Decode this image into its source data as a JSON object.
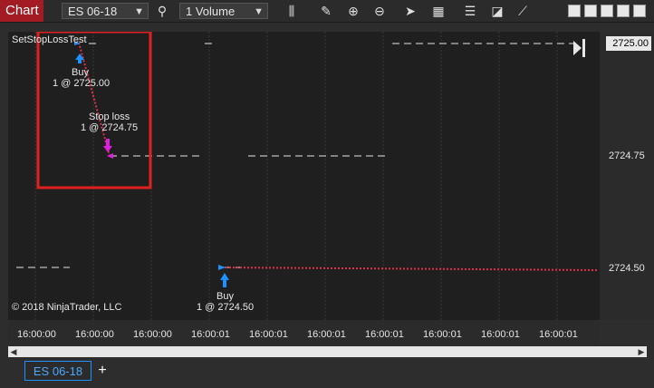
{
  "toolbar": {
    "title": "Chart",
    "instrument": "ES 06-18",
    "interval": "1 Volume"
  },
  "chart": {
    "strategy_label": "SetStopLossTest",
    "copyright": "© 2018 NinjaTrader, LLC",
    "price_axis": {
      "current_price": "2725.00",
      "labels": [
        "2724.75",
        "2724.50"
      ]
    },
    "time_axis": {
      "labels": [
        "16:00:00",
        "16:00:00",
        "16:00:00",
        "16:00:01",
        "16:00:01",
        "16:00:01",
        "16:00:01",
        "16:00:01",
        "16:00:01",
        "16:00:01"
      ]
    },
    "executions": [
      {
        "side": "Buy",
        "detail": "1 @ 2725.00"
      },
      {
        "side": "Stop loss",
        "detail": "1 @ 2724.75"
      },
      {
        "side": "Buy",
        "detail": "1 @ 2724.50"
      }
    ],
    "colors": {
      "buy": "#1e90ff",
      "stop": "#e020e0",
      "trade_line": "#e0304a",
      "highlight_box": "#e02020"
    }
  },
  "tabs": [
    {
      "label": "ES 06-18"
    }
  ],
  "add_tab_label": "+"
}
